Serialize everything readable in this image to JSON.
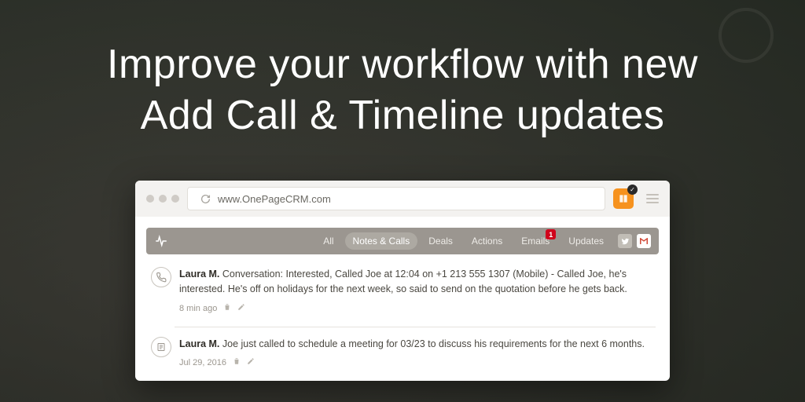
{
  "hero": {
    "line1": "Improve your workflow with new",
    "line2": "Add Call & Timeline updates"
  },
  "browser": {
    "url": "www.OnePageCRM.com",
    "ext_badge_checkmark": "✓"
  },
  "tabs": {
    "all": "All",
    "notes_calls": "Notes & Calls",
    "deals": "Deals",
    "actions": "Actions",
    "emails": "Emails",
    "emails_badge": "1",
    "updates": "Updates"
  },
  "entries": [
    {
      "author": "Laura M.",
      "text": " Conversation: Interested, Called Joe at 12:04 on +1 213 555 1307 (Mobile) - Called Joe, he's interested. He's off on holidays for the next week, so said to send on the quotation before he gets back.",
      "time": "8 min ago"
    },
    {
      "author": "Laura M.",
      "text": " Joe just called to schedule a meeting for 03/23 to discuss his requirements for the next 6 months.",
      "time": "Jul 29, 2016"
    }
  ]
}
